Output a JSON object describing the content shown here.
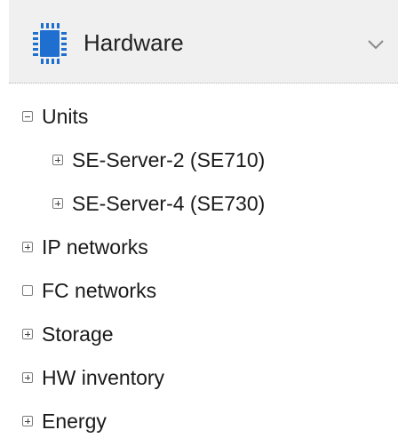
{
  "header": {
    "title": "Hardware",
    "icon": "cpu-chip-icon",
    "collapse_icon": "chevron-down-icon",
    "background": "#f0f0f0",
    "icon_color": "#1f6fd1"
  },
  "tree": {
    "units": {
      "label": "Units",
      "state": "expanded"
    },
    "server_2": {
      "label": "SE-Server-2 (SE710)",
      "state": "collapsed"
    },
    "server_4": {
      "label": "SE-Server-4 (SE730)",
      "state": "collapsed"
    },
    "ip_networks": {
      "label": "IP networks",
      "state": "collapsed"
    },
    "fc_networks": {
      "label": "FC networks",
      "state": "empty"
    },
    "storage": {
      "label": "Storage",
      "state": "collapsed"
    },
    "hw_inventory": {
      "label": "HW inventory",
      "state": "collapsed"
    },
    "energy": {
      "label": "Energy",
      "state": "collapsed"
    }
  }
}
